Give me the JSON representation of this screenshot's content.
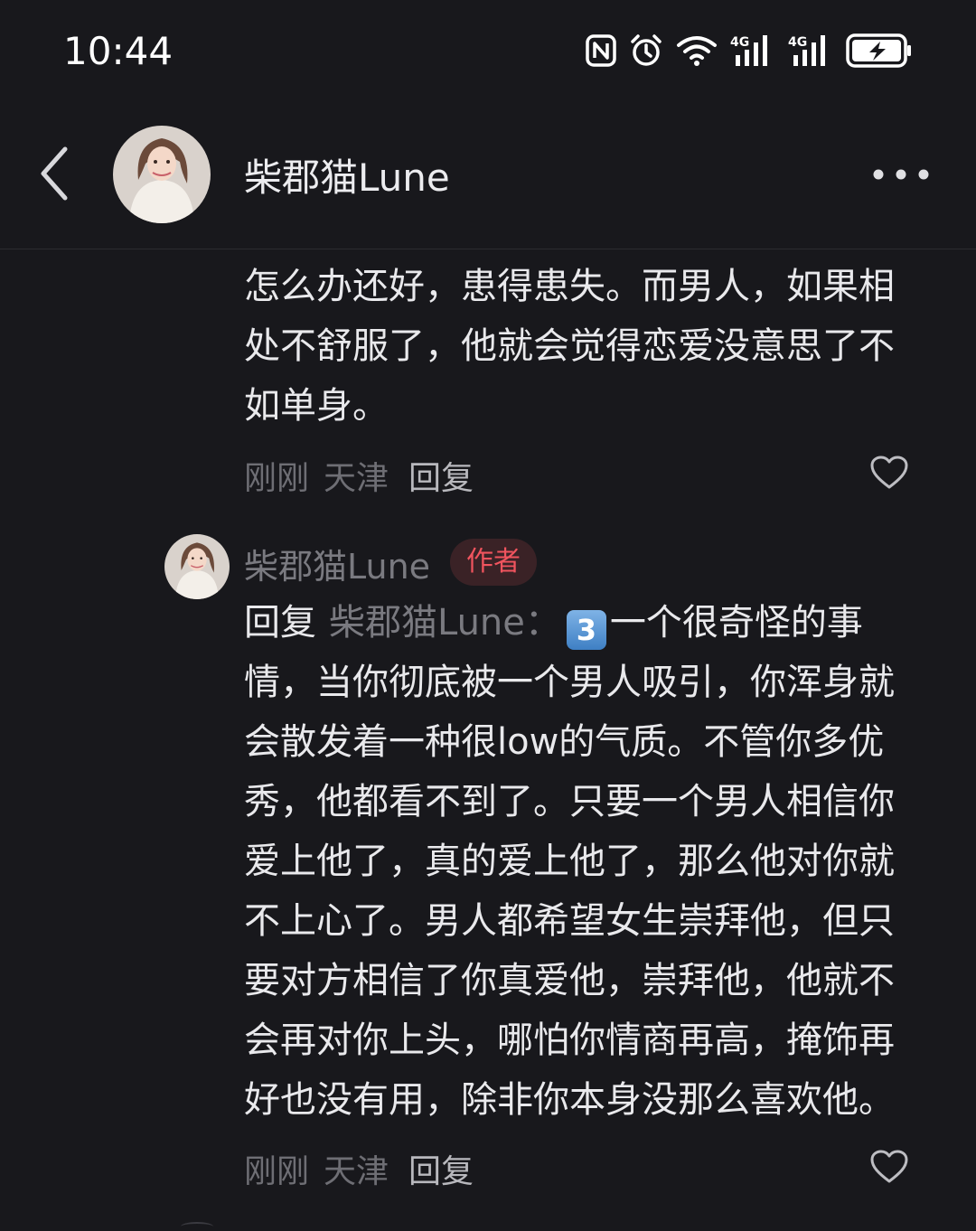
{
  "status_bar": {
    "time": "10:44",
    "icons": [
      "nfc-icon",
      "alarm-icon",
      "wifi-icon",
      "signal-4g-icon",
      "signal-4g-icon",
      "battery-charging-icon"
    ],
    "network_labels": [
      "4G",
      "4G"
    ]
  },
  "header": {
    "title": "柴郡猫Lune"
  },
  "comments": [
    {
      "text_lines": [
        "怎么办还好，患得患失。而男人，如果相",
        "处不舒服了，他就会觉得恋爱没意思了不",
        "如单身。"
      ],
      "time": "刚刚",
      "location": "天津",
      "reply_label": "回复"
    },
    {
      "author": "柴郡猫Lune",
      "badge": "作者",
      "reply_prefix": "回复",
      "reply_to": "柴郡猫Lune：",
      "keycap": "3",
      "first_line_rest": "一个很奇怪的事",
      "text_lines": [
        "情，当你彻底被一个男人吸引，你浑身就",
        "会散发着一种很low的气质。不管你多优",
        "秀，他都看不到了。只要一个男人相信你",
        "爱上他了，真的爱上他了，那么他对你就",
        "不上心了。男人都希望女生崇拜他，但只",
        "要对方相信了你真爱他，崇拜他，他就不",
        "会再对你上头，哪怕你情商再高，掩饰再",
        "好也没有用，除非你本身没那么喜欢他。"
      ],
      "time": "刚刚",
      "location": "天津",
      "reply_label": "回复"
    }
  ],
  "colors": {
    "background": "#18181c",
    "text": "#e9e9ec",
    "muted": "#6e6e74",
    "badge_text": "#f0545e",
    "badge_bg": "#3a2226"
  }
}
